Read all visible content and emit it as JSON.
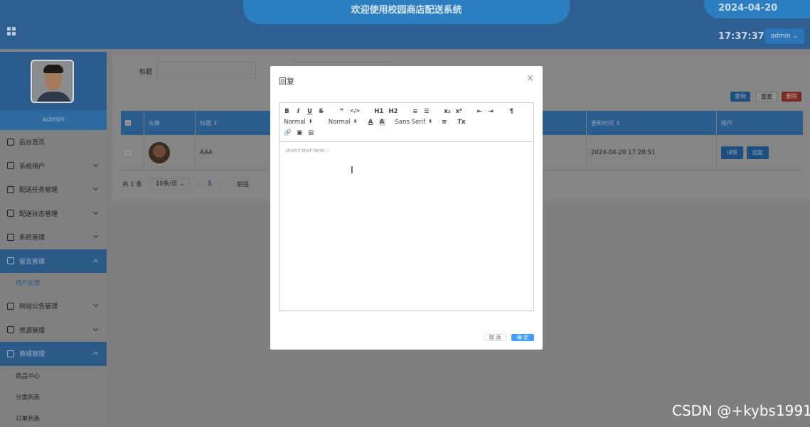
{
  "header": {
    "title": "欢迎使用校园商店配送系统",
    "datetime": "2024-04-20 17:37:37",
    "user_button": "admin ⌄"
  },
  "sidebar": {
    "username": "admin",
    "items": [
      {
        "label": "后台首页",
        "icon": "home-icon"
      },
      {
        "label": "系统用户",
        "icon": "monitor-icon"
      },
      {
        "label": "配送任务管理",
        "icon": "bookmark-icon"
      },
      {
        "label": "配送状态管理",
        "icon": "tag-icon"
      },
      {
        "label": "系统管理",
        "icon": "sun-icon"
      },
      {
        "label": "留言管理",
        "icon": "message-icon"
      },
      {
        "label": "用户反馈",
        "icon": ""
      },
      {
        "label": "网站公告管理",
        "icon": "clipboard-icon"
      },
      {
        "label": "资源管理",
        "icon": "monitor-icon"
      },
      {
        "label": "商城管理",
        "icon": "shop-icon"
      },
      {
        "label": "商品中心",
        "icon": ""
      },
      {
        "label": "分类列表",
        "icon": ""
      },
      {
        "label": "订单列表",
        "icon": ""
      }
    ]
  },
  "search": {
    "label": "标题",
    "query_button": "查询",
    "reset_button": "重置",
    "delete_button": "删除"
  },
  "table": {
    "headers": [
      "头像",
      "标题 ⇕",
      "更新时间 ⇕",
      "操作"
    ],
    "rows": [
      {
        "title": "AAA",
        "updated": "2024-04-20 17:28:51",
        "detail_button": "详情",
        "reply_button": "回复"
      }
    ]
  },
  "pager": {
    "total": "共 1 条",
    "page_size": "10条/页 ⌄",
    "prev": "‹",
    "current": "1",
    "next": "›",
    "goto": "前往"
  },
  "modal": {
    "title": "回复",
    "close": "×",
    "toolbar": {
      "row1": [
        "B",
        "I",
        "U",
        "S",
        "❞",
        "</>",
        "H1",
        "H2",
        "≡",
        "☰",
        "x₂",
        "x²",
        "⇤",
        "⇥",
        "¶"
      ],
      "header_picker": "Normal",
      "size_picker": "Normal",
      "font_picker": "Sans Serif",
      "row2_extra": [
        "A",
        "A",
        "≡",
        "Tx"
      ],
      "row3": [
        "🔗",
        "▣",
        "▤"
      ]
    },
    "placeholder": "Insert text here ...",
    "cancel": "取 消",
    "confirm": "确 定"
  },
  "watermark": "CSDN @+kybs1991",
  "colors": {
    "confirm": "#409eff",
    "header": "#2b7fc1"
  }
}
